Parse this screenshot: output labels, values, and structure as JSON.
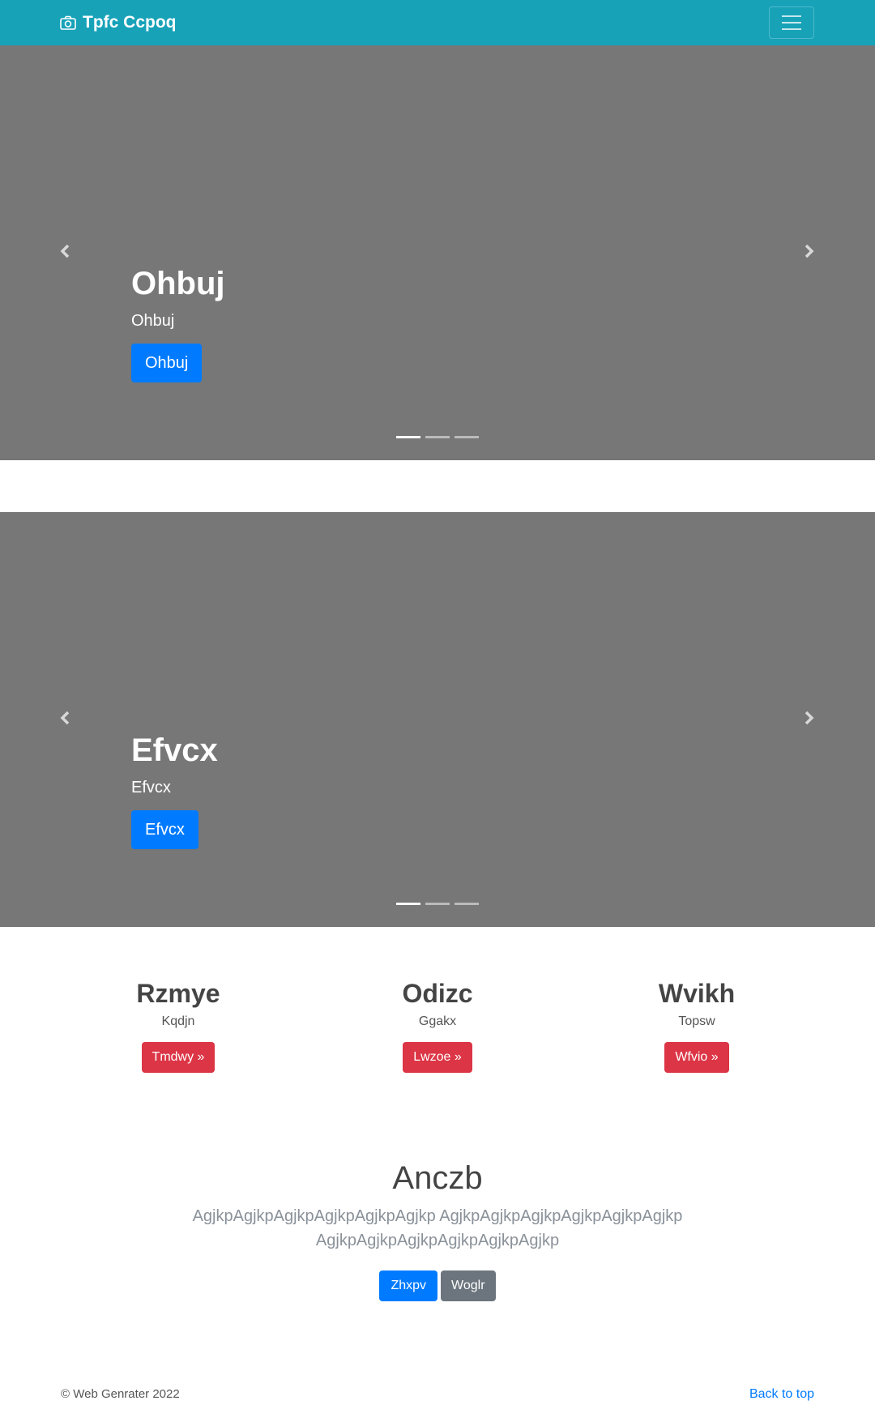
{
  "navbar": {
    "brand": "Tpfc Ccpoq",
    "brand_icon": "camera-icon",
    "toggler_icon": "hamburger-menu-icon",
    "bg_color": "#17a2b8"
  },
  "carousels": [
    {
      "title": "Ohbuj",
      "subtitle": "Ohbuj",
      "button": "Ohbuj",
      "slides": 3,
      "active_slide": 1
    },
    {
      "title": "Efvcx",
      "subtitle": "Efvcx",
      "button": "Efvcx",
      "slides": 3,
      "active_slide": 1
    }
  ],
  "features": [
    {
      "title": "Rzmye",
      "text": "Kqdjn",
      "button": "Tmdwy »"
    },
    {
      "title": "Odizc",
      "text": "Ggakx",
      "button": "Lwzoe »"
    },
    {
      "title": "Wvikh",
      "text": "Topsw",
      "button": "Wfvio »"
    }
  ],
  "jumbotron": {
    "heading": "Anczb",
    "lead": "AgjkpAgjkpAgjkpAgjkpAgjkpAgjkp AgjkpAgjkpAgjkpAgjkpAgjkpAgjkp AgjkpAgjkpAgjkpAgjkpAgjkpAgjkp",
    "primary_button": "Zhxpv",
    "secondary_button": "Woglr"
  },
  "footer": {
    "copyright": "© Web Genrater 2022",
    "back_to_top": "Back to top"
  },
  "colors": {
    "primary": "#007bff",
    "danger": "#dc3545",
    "secondary": "#6c757d",
    "carousel_bg": "#777777"
  }
}
